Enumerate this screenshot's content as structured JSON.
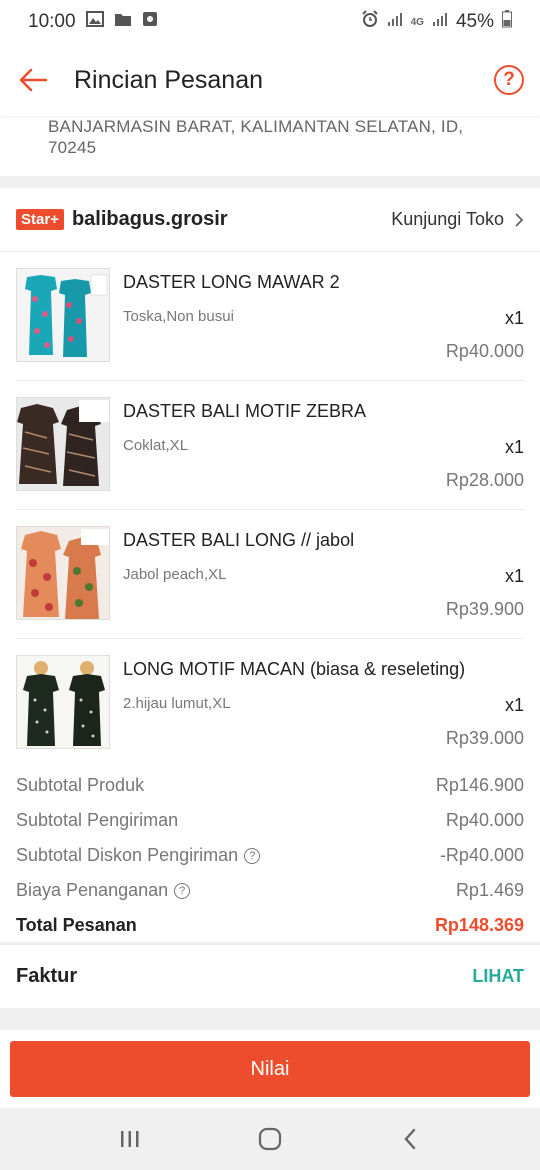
{
  "status_bar": {
    "time": "10:00",
    "network": "4G",
    "battery": "45%"
  },
  "header": {
    "title": "Rincian Pesanan"
  },
  "address": {
    "text": "BANJARMASIN BARAT, KALIMANTAN SELATAN, ID, 70245"
  },
  "shop": {
    "badge": "Star+",
    "name": "balibagus.grosir",
    "visit_label": "Kunjungi Toko"
  },
  "products": [
    {
      "name": "DASTER LONG MAWAR 2",
      "variant": "Toska,Non busui",
      "qty": "x1",
      "price": "Rp40.000"
    },
    {
      "name": "DASTER BALI MOTIF ZEBRA",
      "variant": "Coklat,XL",
      "qty": "x1",
      "price": "Rp28.000"
    },
    {
      "name": "DASTER BALI LONG // jabol",
      "variant": "Jabol peach,XL",
      "qty": "x1",
      "price": "Rp39.900"
    },
    {
      "name": "LONG MOTIF MACAN (biasa & reseleting)",
      "variant": "2.hijau lumut,XL",
      "qty": "x1",
      "price": "Rp39.000"
    }
  ],
  "summary": {
    "subtotal_product_label": "Subtotal Produk",
    "subtotal_product": "Rp146.900",
    "subtotal_shipping_label": "Subtotal Pengiriman",
    "subtotal_shipping": "Rp40.000",
    "shipping_discount_label": "Subtotal Diskon Pengiriman",
    "shipping_discount": "-Rp40.000",
    "handling_fee_label": "Biaya Penanganan",
    "handling_fee": "Rp1.469",
    "total_label": "Total Pesanan",
    "total": "Rp148.369"
  },
  "invoice": {
    "label": "Faktur",
    "link": "LIHAT"
  },
  "actions": {
    "rate_label": "Nilai"
  },
  "colors": {
    "accent": "#ee4d2d",
    "link": "#26aa99"
  }
}
